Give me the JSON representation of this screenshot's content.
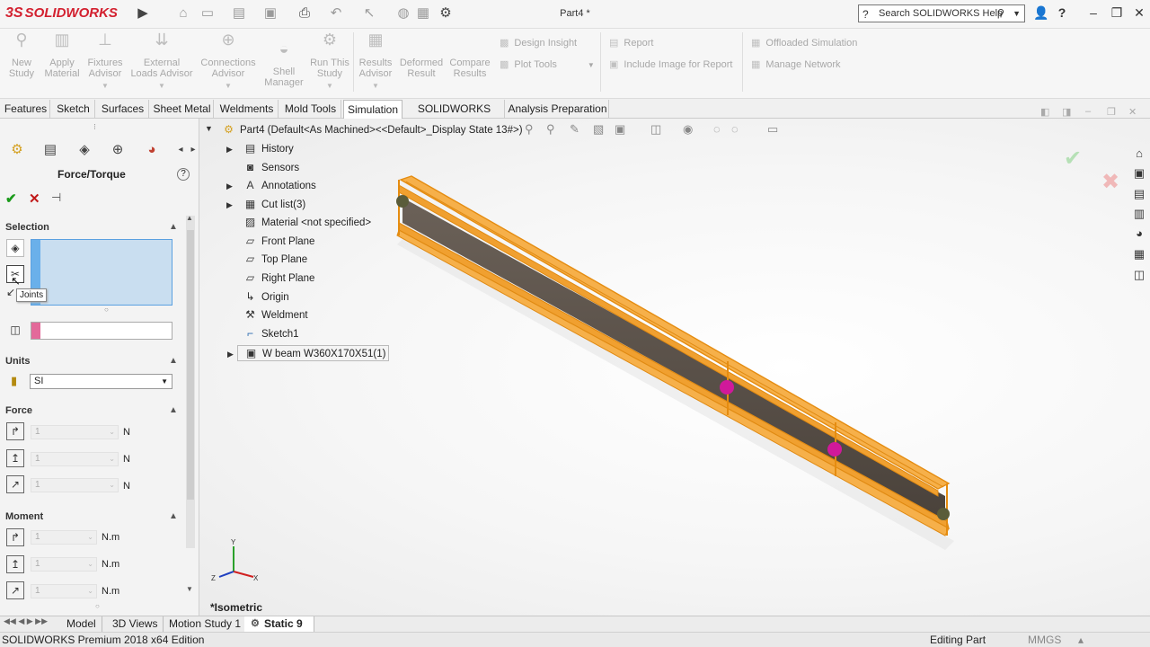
{
  "app": {
    "logo_mark": "3S",
    "logo_text": "SOLIDWORKS",
    "doc_title": "Part4 *",
    "search_placeholder": "Search SOLIDWORKS Help"
  },
  "command_manager": {
    "big_buttons": [
      {
        "label": "New Study",
        "icon": "new-study-icon"
      },
      {
        "label": "Apply Material",
        "icon": "apply-material-icon"
      },
      {
        "label": "Fixtures Advisor",
        "icon": "fixtures-icon"
      },
      {
        "label": "External Loads Advisor",
        "icon": "external-loads-icon"
      },
      {
        "label": "Connections Advisor",
        "icon": "connections-icon"
      },
      {
        "label": "Shell Manager",
        "icon": "shell-manager-icon"
      },
      {
        "label": "Run This Study",
        "icon": "run-study-icon"
      },
      {
        "label": "Results Advisor",
        "icon": "results-advisor-icon"
      },
      {
        "label": "Deformed Result",
        "icon": "deformed-result-icon"
      },
      {
        "label": "Compare Results",
        "icon": "compare-results-icon"
      }
    ],
    "small_buttons": [
      {
        "label": "Design Insight"
      },
      {
        "label": "Plot Tools"
      },
      {
        "label": "Report"
      },
      {
        "label": "Include Image for Report"
      },
      {
        "label": "Offloaded Simulation"
      },
      {
        "label": "Manage Network"
      }
    ]
  },
  "tabs": [
    "Features",
    "Sketch",
    "Surfaces",
    "Sheet Metal",
    "Weldments",
    "Mold Tools",
    "Simulation",
    "SOLIDWORKS CAM",
    "Analysis Preparation"
  ],
  "active_tab": "Simulation",
  "property_manager": {
    "title": "Force/Torque",
    "tooltip": "Joints",
    "selection_header": "Selection",
    "units_header": "Units",
    "units_value": "SI",
    "force_header": "Force",
    "force_rows": [
      {
        "value": "1",
        "unit": "N"
      },
      {
        "value": "1",
        "unit": "N"
      },
      {
        "value": "1",
        "unit": "N"
      }
    ],
    "moment_header": "Moment",
    "moment_rows": [
      {
        "value": "1",
        "unit": "N.m"
      },
      {
        "value": "1",
        "unit": "N.m"
      },
      {
        "value": "1",
        "unit": "N.m"
      }
    ]
  },
  "feature_tree": {
    "root": "Part4  (Default<As Machined><<Default>_Display State 13#>)",
    "items": [
      {
        "label": "History",
        "expandable": true
      },
      {
        "label": "Sensors",
        "expandable": false
      },
      {
        "label": "Annotations",
        "expandable": true
      },
      {
        "label": "Cut list(3)",
        "expandable": true
      },
      {
        "label": "Material <not specified>",
        "expandable": false
      },
      {
        "label": "Front Plane",
        "expandable": false
      },
      {
        "label": "Top Plane",
        "expandable": false
      },
      {
        "label": "Right Plane",
        "expandable": false
      },
      {
        "label": "Origin",
        "expandable": false
      },
      {
        "label": "Weldment",
        "expandable": false
      },
      {
        "label": "Sketch1",
        "expandable": false
      },
      {
        "label": "W beam W360X170X51(1)",
        "expandable": true
      }
    ]
  },
  "viewport": {
    "view_label": "*Isometric",
    "triad": {
      "x": "X",
      "y": "Y",
      "z": "Z"
    }
  },
  "bottom_tabs": [
    "Model",
    "3D Views",
    "Motion Study 1",
    "Static 9"
  ],
  "status": {
    "left": "SOLIDWORKS Premium 2018 x64 Edition",
    "editing": "Editing Part",
    "units": "MMGS"
  },
  "colors": {
    "beam": "#f0a030",
    "web": "#5a5048",
    "brand": "#d3202f",
    "joint_marker": "#d0199a"
  }
}
